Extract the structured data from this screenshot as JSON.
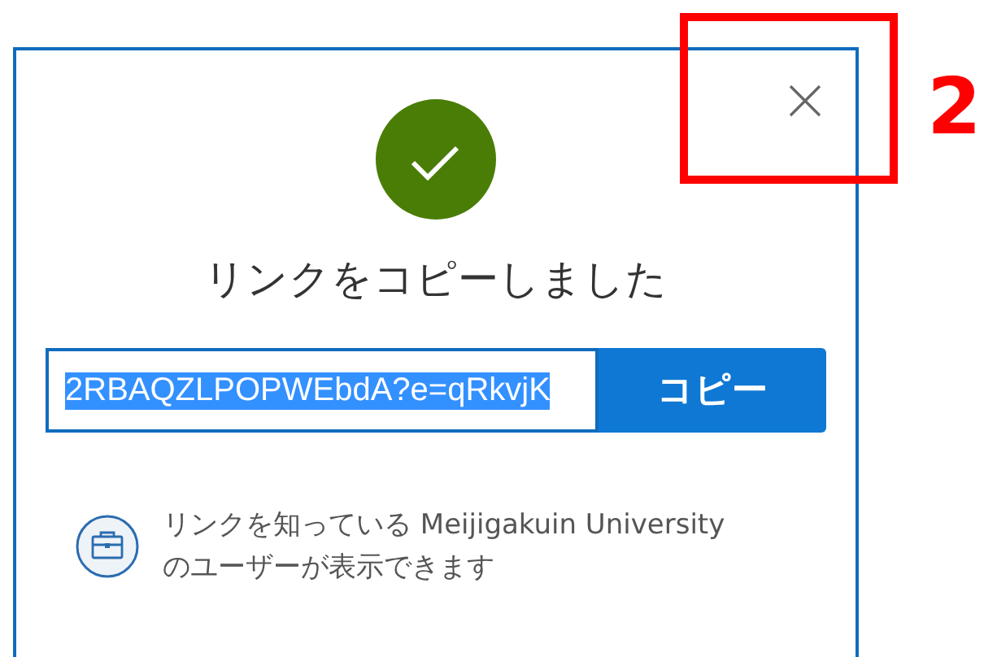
{
  "dialog": {
    "status_icon": {
      "kind": "success"
    },
    "title": "リンクをコピーしました",
    "link": {
      "value": "2RBAQZLPOPWEbdA?e=qRkvjK",
      "selected": true
    },
    "copy_button": "コピー",
    "info": {
      "kind": "organization",
      "text": "リンクを知っている Meijigakuin University のユーザーが表示できます"
    }
  },
  "annotation": {
    "label": "2"
  }
}
